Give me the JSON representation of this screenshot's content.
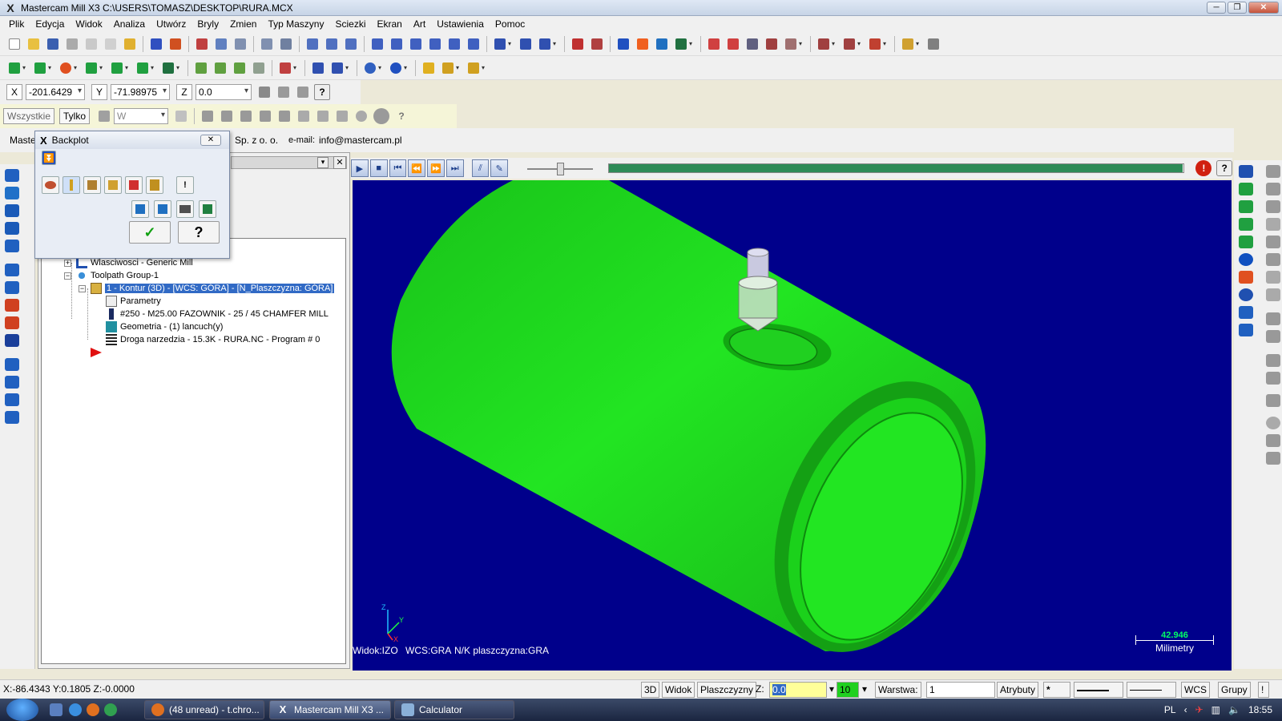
{
  "window": {
    "title": "Mastercam Mill X3  C:\\USERS\\TOMASZ\\DESKTOP\\RURA.MCX",
    "controls": [
      "─",
      "❐",
      "✕"
    ]
  },
  "menu": [
    "Plik",
    "Edycja",
    "Widok",
    "Analiza",
    "Utwórz",
    "Bryly",
    "Zmien",
    "Typ Maszyny",
    "Sciezki",
    "Ekran",
    "Art",
    "Ustawienia",
    "Pomoc"
  ],
  "coords": {
    "x_label": "X",
    "x_value": "-201.6429",
    "y_label": "Y",
    "y_value": "-71.98975",
    "z_label": "Z",
    "z_value": "0.0",
    "help": "?"
  },
  "selection": {
    "all_label": "Wszystkie",
    "only_label": "Tylko",
    "mode_value": "W",
    "help": "?"
  },
  "infobar": {
    "prefix": "Master",
    "company": "Sp. z o. o.",
    "email_label": "e-mail:",
    "email": "info@mastercam.pl"
  },
  "backplot": {
    "title": "Backplot",
    "ok_glyph": "✓",
    "help_glyph": "?",
    "info_glyph": "!"
  },
  "tree": {
    "properties": "Wlasciwosci - Generic Mill",
    "group": "Toolpath Group-1",
    "operation": "1 - Kontur (3D) - [WCS: GÓRA] - [N_Plaszczyzna: GÓRA]",
    "params": "Parametry",
    "tool": "#250 - M25.00 FAZOWNIK -   25 / 45 CHAMFER MILL",
    "geometry": "Geometria - (1) lancuch(y)",
    "toolpath": "Droga narzedzia - 15.3K - RURA.NC - Program # 0"
  },
  "simulation": {
    "progress": 0.995,
    "slider_level": 0.5,
    "help": "?"
  },
  "viewport": {
    "background": "#00008b",
    "pipe_color": "#1fe01f",
    "view_label": "Widok:IZO",
    "wcs_label": "WCS:GRA",
    "plane_label": "N/K plaszczyzna:GRA",
    "scale_value": "42.946",
    "scale_unit": "Milimetry",
    "axis_y": "Y",
    "axis_z": "Z",
    "axis_x": "X"
  },
  "status": {
    "cursor": "X:-86.4343   Y:0.1805   Z:-0.0000",
    "btn_3d": "3D",
    "btn_view": "Widok",
    "btn_planes": "Plaszczyzny",
    "z_label": "Z:",
    "z_value": "0.0",
    "color_value": "10",
    "layer_label": "Warstwa:",
    "layer_value": "1",
    "attrs": "Atrybuty",
    "point_style": "*",
    "wcs": "WCS",
    "groups": "Grupy",
    "more": "!"
  },
  "taskbar": {
    "tasks": [
      "(48 unread) - t.chro...",
      "Mastercam Mill X3  ...",
      "Calculator"
    ],
    "language": "PL",
    "clock": "18:55"
  }
}
